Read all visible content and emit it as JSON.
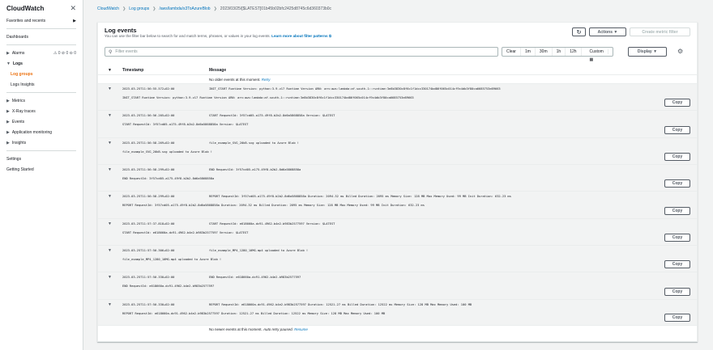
{
  "sidebar": {
    "title": "CloudWatch",
    "favorites": "Favorites and recents",
    "dashboards": "Dashboards",
    "alarms": {
      "label": "Alarms",
      "a": "0",
      "b": "0",
      "c": "0"
    },
    "logs": "Logs",
    "log_groups": "Log groups",
    "logs_insights": "Logs Insights",
    "metrics": "Metrics",
    "xray": "X-Ray traces",
    "events": "Events",
    "app_mon": "Application monitoring",
    "insights": "Insights",
    "settings": "Settings",
    "getting_started": "Getting Started"
  },
  "breadcrumb": {
    "b1": "CloudWatch",
    "b2": "Log groups",
    "b3": "/aws/lambda/s3ToAzureBlob",
    "b4": "2023/03/25/[$LATEST]01b45b02bfc2425d8745c6d360373b0c"
  },
  "panel": {
    "title": "Log events",
    "desc": "You can use the filter bar below to search for and match terms, phrases, or values in your log events.",
    "learn": "Learn more about filter patterns",
    "actions": "Actions",
    "create_metric": "Create metric filter",
    "filter_placeholder": "Filter events",
    "ranges": [
      "Clear",
      "1m",
      "30m",
      "1h",
      "12h",
      "Custom"
    ],
    "display": "Display",
    "col_timestamp": "Timestamp",
    "col_message": "Message",
    "no_older": "No older events at this moment.",
    "retry": "Retry",
    "no_newer_a": "No newer events at this moment.",
    "no_newer_b": "Auto retry paused.",
    "resume": "Resume",
    "copy": "Copy"
  },
  "events": [
    {
      "ts": "2023-03-25T11:56:55.572+02:00",
      "msg": "INIT_START Runtime Version: python:3.9.v17 Runtime Version ARN: arn:aws:lambda:af-south-1::runtime:3e8b3830c8f6c1f1dcc330174bd86f065c014cf9c4db3f80ca6685753e89663",
      "detail": "INIT_START Runtime Version: python:3.9.v17      Runtime Version ARN: arn:aws:lambda:af-south-1::runtime:3e8b3830c8f6c1f1dcc330174bd86f065c014cf9c4db3f80ca6685753e89663"
    },
    {
      "ts": "2023-03-25T11:56:56.205+02:00",
      "msg": "START RequestId: 3f57cd05-a175-49f8-b2b2-8d6a5868858a Version: $LATEST",
      "detail": "START RequestId: 3f57cd05-a175-49f8-b2b2-8d6a5868858a Version: $LATEST"
    },
    {
      "ts": "2023-03-25T11:56:58.269+02:00",
      "msg": "file_example_SVG_20kB.svg uploaded to Azure Blob !",
      "detail": "file_example_SVG_20kB.svg uploaded to Azure Blob !"
    },
    {
      "ts": "2023-03-25T11:56:58.299+02:00",
      "msg": "END RequestId: 3f57cd05-a175-49f8-b2b2-8d6a5868858a",
      "detail": "END RequestId: 3f57cd05-a175-49f8-b2b2-8d6a5868858a"
    },
    {
      "ts": "2023-03-25T11:56:58.299+02:00",
      "msg": "REPORT RequestId: 3f57cd05-a175-49f8-b2b2-8d6a5868858a Duration: 2094.32 ms Billed Duration: 2095 ms Memory Size: 128 MB Max Memory Used: 99 MB Init Duration: 632.23 ms",
      "detail": "REPORT RequestId: 3f57cd05-a175-49f8-b2b2-8d6a5868858a  Duration: 2094.32 ms     Billed Duration: 2095 ms        Memory Size: 128 MB     Max Memory Used: 99 MB  Init Duration: 632.23 ms"
    },
    {
      "ts": "2023-03-25T11:57:37.818+02:00",
      "msg": "START RequestId: e618660a-dc91-4962-b4e2-b983b2577597 Version: $LATEST",
      "detail": "START RequestId: e618660a-dc91-4962-b4e2-b983b2577597 Version: $LATEST"
    },
    {
      "ts": "2023-03-25T11:57:50.306+02:00",
      "msg": "file_example_MP4_1280_10MG.mp4 uploaded to Azure Blob !",
      "detail": "file_example_MP4_1280_10MG.mp4 uploaded to Azure Blob !"
    },
    {
      "ts": "2023-03-25T11:57:50.330+02:00",
      "msg": "END RequestId: e618660a-dc91-4962-b4e2-b983b2577597",
      "detail": "END RequestId: e618660a-dc91-4962-b4e2-b983b2577597"
    },
    {
      "ts": "2023-03-25T11:57:50.330+02:00",
      "msg": "REPORT RequestId: e618660a-dc91-4962-b4e2-b983b2577597 Duration: 12521.27 ms Billed Duration: 12522 ms Memory Size: 128 MB Max Memory Used: 100 MB",
      "detail": "REPORT RequestId: e618660a-dc91-4962-b4e2-b983b2577597  Duration: 12521.27 ms    Billed Duration: 12522 ms       Memory Size: 128 MB     Max Memory Used: 100 MB"
    }
  ]
}
